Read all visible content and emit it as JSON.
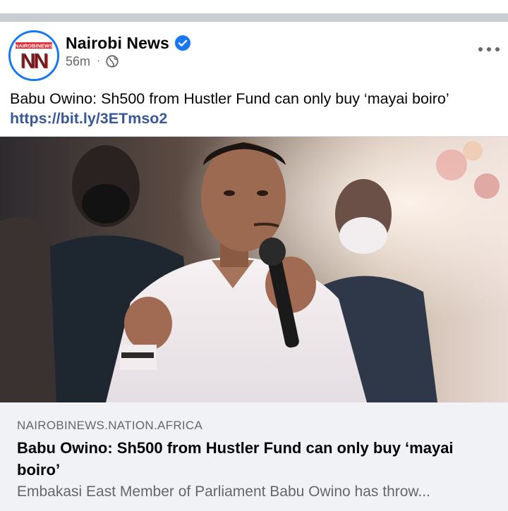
{
  "post": {
    "page_name": "Nairobi News",
    "time_ago": "56m",
    "separator": "·",
    "text": "Babu Owino: Sh500 from Hustler Fund can only buy ‘mayai boiro’",
    "link": "https://bit.ly/3ETmso2",
    "avatar_text_top": "NAIROBINEWS",
    "avatar_letters": "NN"
  },
  "link_preview": {
    "domain": "NAIROBINEWS.NATION.AFRICA",
    "title": "Babu Owino: Sh500 from Hustler Fund can only buy ‘mayai boiro’",
    "description": "Embakasi East Member of Parliament Babu Owino has throw..."
  },
  "icons": {
    "verified": "verified-badge-icon",
    "audience": "globe-icon",
    "more": "more-options-icon"
  },
  "colors": {
    "facebook_blue": "#1877f2",
    "link_blue": "#385898",
    "avatar_red": "#e0262f",
    "secondary_text": "#65676b",
    "preview_bg": "#f0f2f5"
  }
}
